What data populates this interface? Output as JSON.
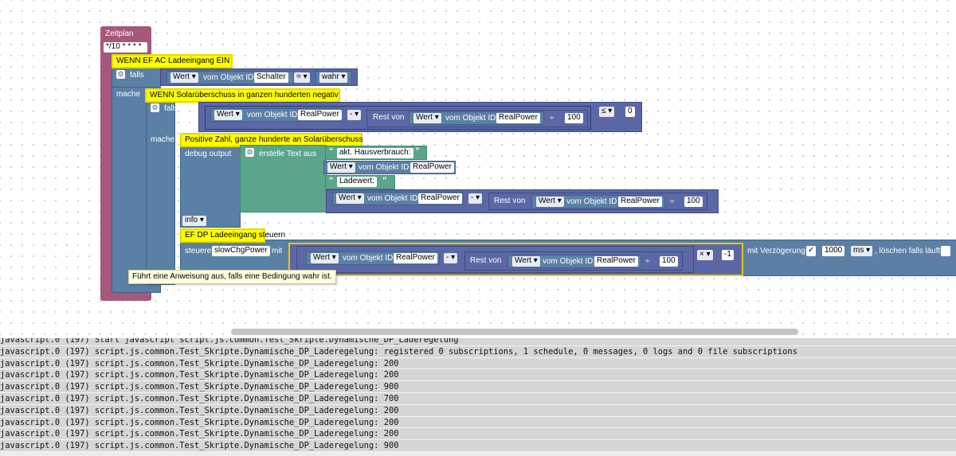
{
  "workspace": {
    "zeitplan": {
      "label": "Zeitplan",
      "cron": "*/10 * * * *"
    },
    "comment1": "WENN EF AC Ladeeingang EIN",
    "if1": {
      "falls": "falls",
      "mache": "mache",
      "cond": {
        "attr": "Wert",
        "obj_label": "vom Objekt ID",
        "obj": "Schalter",
        "op": "=",
        "value": "wahr"
      }
    },
    "comment2": "WENN Solarüberschuss in ganzen hunderten negativ",
    "if2": {
      "falls": "falls",
      "mache": "mache",
      "minus_attr": "Wert",
      "minus_obj_label": "vom Objekt ID",
      "minus_obj": "RealPower",
      "minus_op": "-",
      "rest_label": "Rest von",
      "rest_attr": "Wert",
      "rest_obj_label": "vom Objekt ID",
      "rest_obj": "RealPower",
      "divide": "÷",
      "divisor": "100",
      "cmp_op": "≤",
      "cmp_value": "0"
    },
    "comment3": "Positive Zahl, ganze hunderte an Solarüberschuss",
    "debug": {
      "label": "debug output",
      "create_text": "erstelle Text aus",
      "text1": "akt. Hausverbrauch:",
      "row2_attr": "Wert",
      "row2_obj_label": "vom Objekt ID",
      "row2_obj": "RealPower",
      "text2": "Ladewert:",
      "row4_attr": "Wert",
      "row4_obj_label": "vom Objekt ID",
      "row4_obj": "RealPower",
      "row4_op": "-",
      "rest_label": "Rest von",
      "rest_attr": "Wert",
      "rest_obj_label": "vom Objekt ID",
      "rest_obj": "RealPower",
      "divide": "÷",
      "divisor": "100",
      "level": "info"
    },
    "comment4": "EF DP Ladeeingang steuern",
    "steuere": {
      "label": "steuere",
      "obj": "slowChgPower",
      "mit": "mit",
      "attr": "Wert",
      "obj_label": "vom Objekt ID",
      "obj2": "RealPower",
      "op": "-",
      "rest_label": "Rest von",
      "rest_attr": "Wert",
      "rest_obj_label": "vom Objekt ID",
      "rest_obj": "RealPower",
      "divide": "÷",
      "divisor": "100",
      "mult_op": "×",
      "mult_value": "-1",
      "delay_label": "mit Verzögerung",
      "delay_checked": "✓",
      "delay_value": "1000",
      "delay_unit": "ms",
      "clear_label": ", löschen falls läuft"
    },
    "tooltip": "Führt eine Anweisung aus, falls eine Bedingung wahr ist."
  },
  "console": {
    "lines": [
      "javascript.0 (197) Start javascript script.js.common.Test_Skripte.Dynamische_DP_Laderegelung",
      "javascript.0 (197) script.js.common.Test_Skripte.Dynamische_DP_Laderegelung: registered 0 subscriptions, 1 schedule, 0 messages, 0 logs and 0 file subscriptions",
      "javascript.0 (197) script.js.common.Test_Skripte.Dynamische_DP_Laderegelung: 200",
      "javascript.0 (197) script.js.common.Test_Skripte.Dynamische_DP_Laderegelung: 200",
      "javascript.0 (197) script.js.common.Test_Skripte.Dynamische_DP_Laderegelung: 900",
      "javascript.0 (197) script.js.common.Test_Skripte.Dynamische_DP_Laderegelung: 700",
      "javascript.0 (197) script.js.common.Test_Skripte.Dynamische_DP_Laderegelung: 200",
      "javascript.0 (197) script.js.common.Test_Skripte.Dynamische_DP_Laderegelung: 200",
      "javascript.0 (197) script.js.common.Test_Skripte.Dynamische_DP_Laderegelung: 200",
      "javascript.0 (197) script.js.common.Test_Skripte.Dynamische_DP_Laderegelung: 900"
    ]
  }
}
